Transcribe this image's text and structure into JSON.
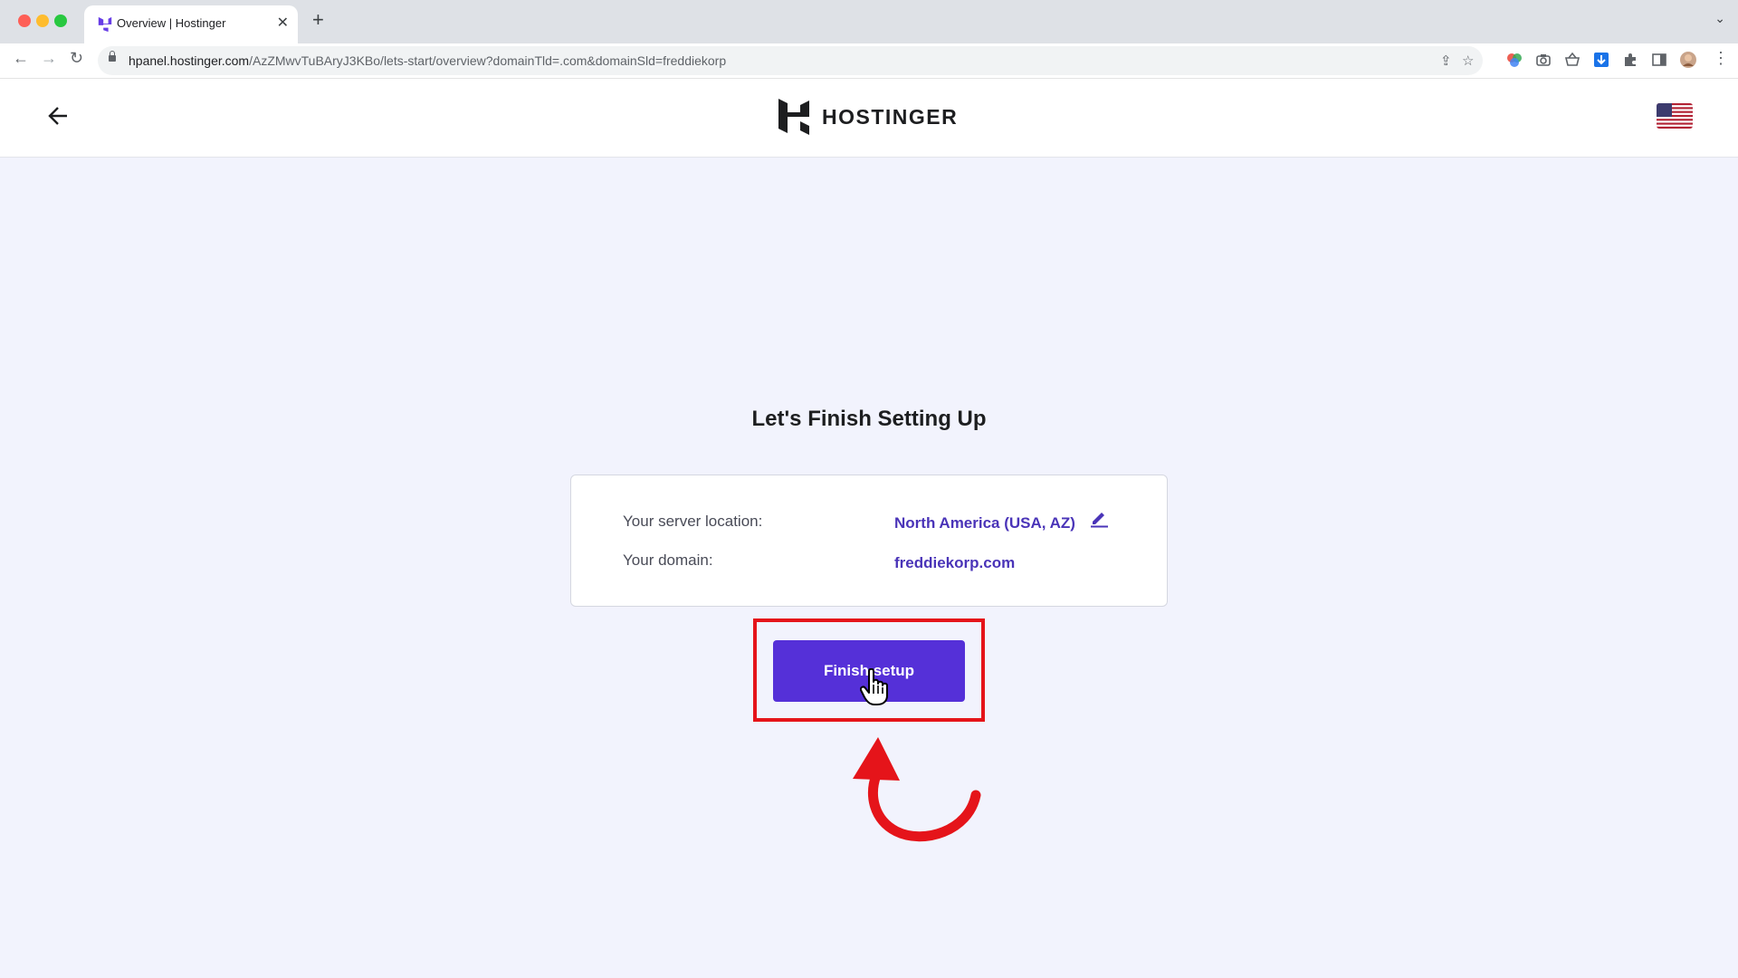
{
  "browser": {
    "tab_title": "Overview | Hostinger",
    "url_host": "hpanel.hostinger.com",
    "url_path": "/AzZMwvTuBAryJ3KBo/lets-start/overview?domainTld=.com&domainSld=freddiekorp",
    "icons": [
      "back-icon",
      "forward-icon",
      "reload-icon",
      "share-icon",
      "star-icon",
      "extension-icons",
      "puzzle-icon",
      "sidepanel-icon",
      "profile-avatar",
      "menu-icon"
    ]
  },
  "header": {
    "logo_text": "HOSTINGER",
    "language_flag": "us-flag"
  },
  "main": {
    "title": "Let's Finish Setting Up",
    "server_location_label": "Your server location:",
    "server_location_value": "North America (USA, AZ)",
    "domain_label": "Your domain:",
    "domain_value": "freddiekorp.com",
    "finish_button": "Finish setup"
  },
  "colors": {
    "accent": "#5530d8",
    "link": "#4a34b8",
    "annotation": "#e5141a",
    "page_bg": "#f2f3fd"
  }
}
